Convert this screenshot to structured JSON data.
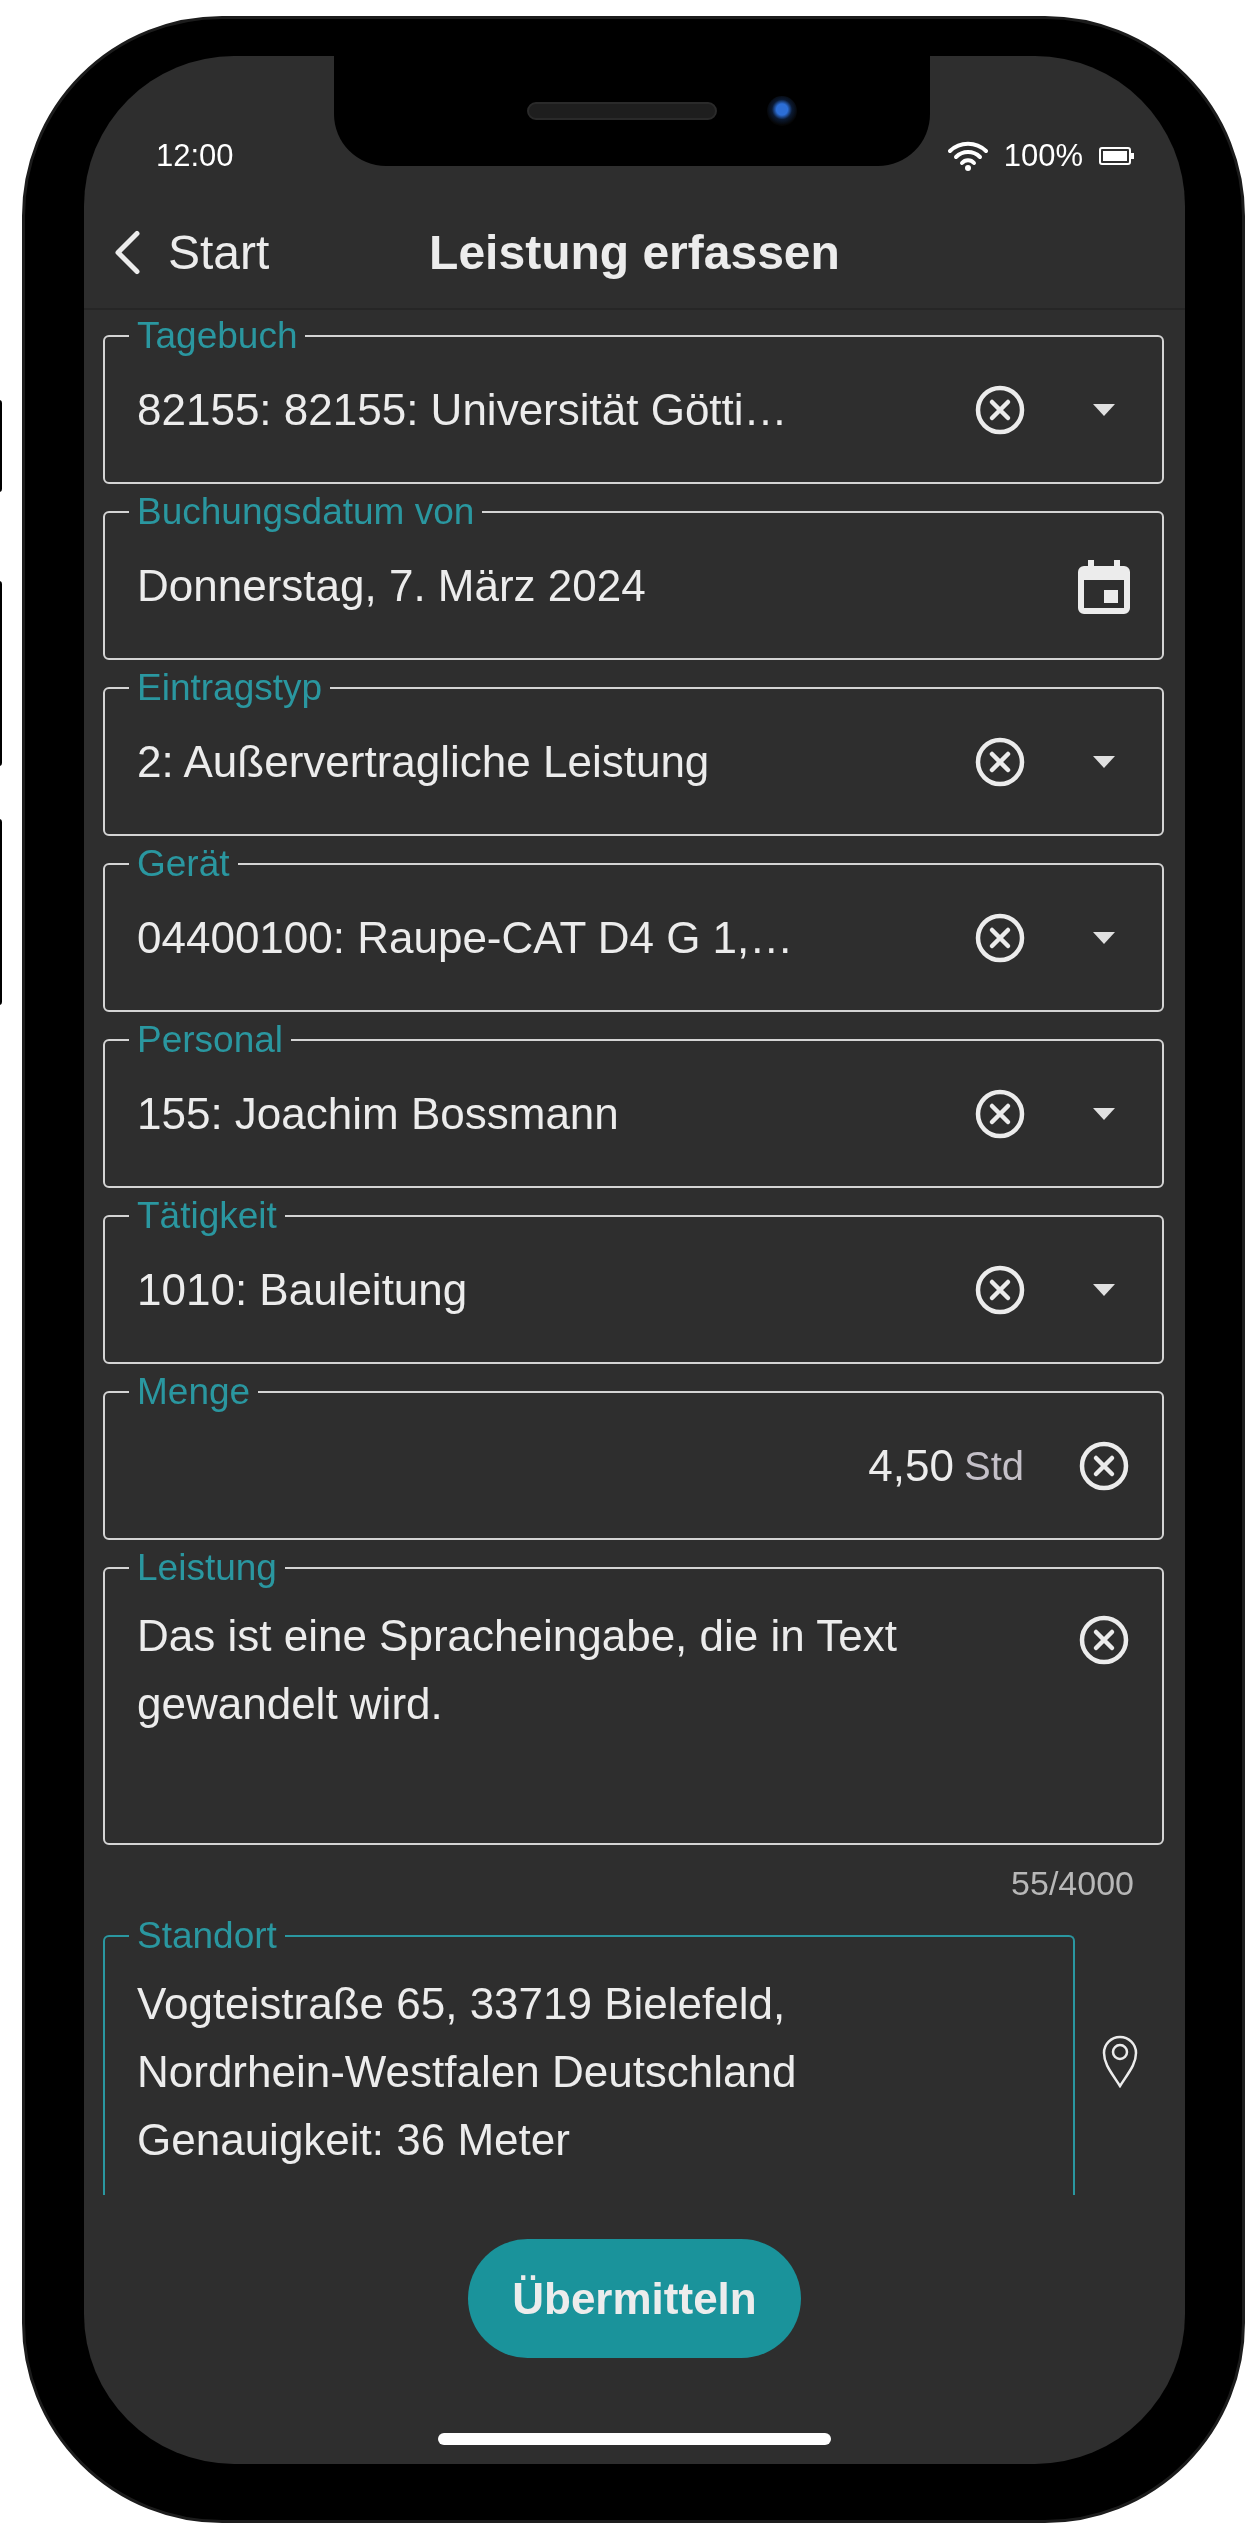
{
  "status_bar": {
    "time": "12:00",
    "battery": "100%"
  },
  "nav": {
    "back": "Start",
    "title": "Leistung erfassen"
  },
  "fields": [
    {
      "kind": "select",
      "label": "Tagebuch",
      "value": "82155: 82155: Universität Götti…",
      "focused": false
    },
    {
      "kind": "date",
      "label": "Buchungsdatum von",
      "value": "Donnerstag, 7. März 2024",
      "focused": false
    },
    {
      "kind": "select",
      "label": "Eintragstyp",
      "value": "2: Außervertragliche Leistung",
      "focused": false
    },
    {
      "kind": "select",
      "label": "Gerät",
      "value": "04400100: Raupe-CAT D4 G 1,…",
      "focused": false
    },
    {
      "kind": "select",
      "label": "Personal",
      "value": "155: Joachim Bossmann",
      "focused": false
    },
    {
      "kind": "select",
      "label": "Tätigkeit",
      "value": "1010: Bauleitung",
      "focused": false
    },
    {
      "kind": "number",
      "label": "Menge",
      "value": "4,50",
      "unit": "Std",
      "focused": false
    },
    {
      "kind": "text",
      "label": "Leistung",
      "value": "Das ist eine Spracheingabe, die in Text gewandelt wird.",
      "counter": "55/4000",
      "focused": false
    },
    {
      "kind": "location",
      "label": "Standort",
      "lines": [
        "Vogteistraße 65, 33719 Bielefeld,",
        "Nordrhein-Westfalen Deutschland",
        "Genauigkeit: 36 Meter"
      ],
      "focused": true
    }
  ],
  "submit": "Übermitteln"
}
